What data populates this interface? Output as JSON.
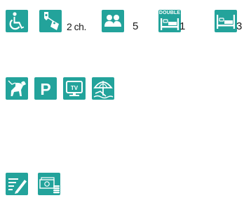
{
  "colors": {
    "tile": "#23a39b",
    "text": "#1a1a1a"
  },
  "row1": {
    "rooms": "2 ch.",
    "guests": "5",
    "double_label": "DOUBLE",
    "double_beds": "1",
    "single_beds": "3"
  },
  "row2": {
    "parking_letter": "P",
    "tv_label": "TV"
  },
  "icons": [
    "wheelchair-icon",
    "room-key-icon",
    "people-icon",
    "double-bed-icon",
    "single-bed-icon",
    "pets-allowed-icon",
    "parking-icon",
    "tv-icon",
    "beach-umbrella-icon",
    "checklist-pen-icon",
    "cash-coins-icon"
  ]
}
